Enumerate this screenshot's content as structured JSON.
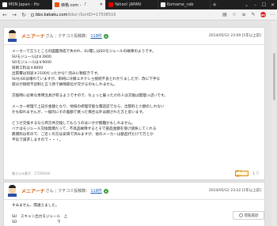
{
  "tabs": [
    {
      "label": "MSN Japan - Ho"
    },
    {
      "label": "価格.com - 「"
    },
    {
      "label": "Yahoo! JAPAN"
    },
    {
      "label": "Komame_cab"
    }
  ],
  "address": {
    "domain": "bbs.kakaku.com",
    "path": "/bbs/-/SortID=17508516"
  },
  "extension_label": "ABP",
  "post1": {
    "user": "メニアーナ",
    "honorific": "さん",
    "posts_label": "クチコミ投稿数：",
    "posts_count": "118件",
    "date": "2014/05/12 23:09 [1年以上前]",
    "lines": [
      "メーカーで言うところの図面改成で失われ、SU電しはSOモジュールの故障のようです。",
      "SUモジュールは￥2800",
      "SOモジュールは￥9000",
      "技術工料は￥8000",
      "出張費は別途￥2100だったかな？因みに税抜きです。",
      "SUもSOは壊れていますが、単純に冷媒ユネクショ接続不良とわかりましたが、改に下手な",
      "部分が接続不良制と言う改で故障部位が交がるのもしれません。",
      "",
      "交換時に必要な専用治具が有るようですので、ちょっと厳ったけの人は交換は無理っぽいです。",
      "",
      "メーカー修理で上記の金額となり、地域の修理可能な電話店でなら、出張料と少額のしれない",
      "かも知れませんが、一般的にその差額で買った場合以外は額された方と思います。",
      "",
      "どうせ交換するなら両方共交換してもらうのはいかが無難かもしれません。",
      "バナはモジュール交換無償だって、不具品故障するとそで部品金額を受け請負してくれる",
      "無償料は年ので、ご近くの方は安価で済みますが、他のメーカーは部品代だけで万とか",
      "平気で請求しますので・・・。"
    ],
    "id": "書き込み番号：17509046",
    "naisu_label": "ナイス！",
    "naisu_count": "1"
  },
  "post2": {
    "user": "メニアーナ",
    "honorific": "さん",
    "posts_label": "クチコミ投稿数：",
    "posts_count": "118件",
    "date": "2014/05/12 23:22 [1年以上前]",
    "lines": [
      "すみません、間違えました。",
      "",
      "SU　スキャン出力モジュール　上",
      "SO　　　　　　　　　　　下"
    ]
  },
  "float_button": "閲覧履歴"
}
